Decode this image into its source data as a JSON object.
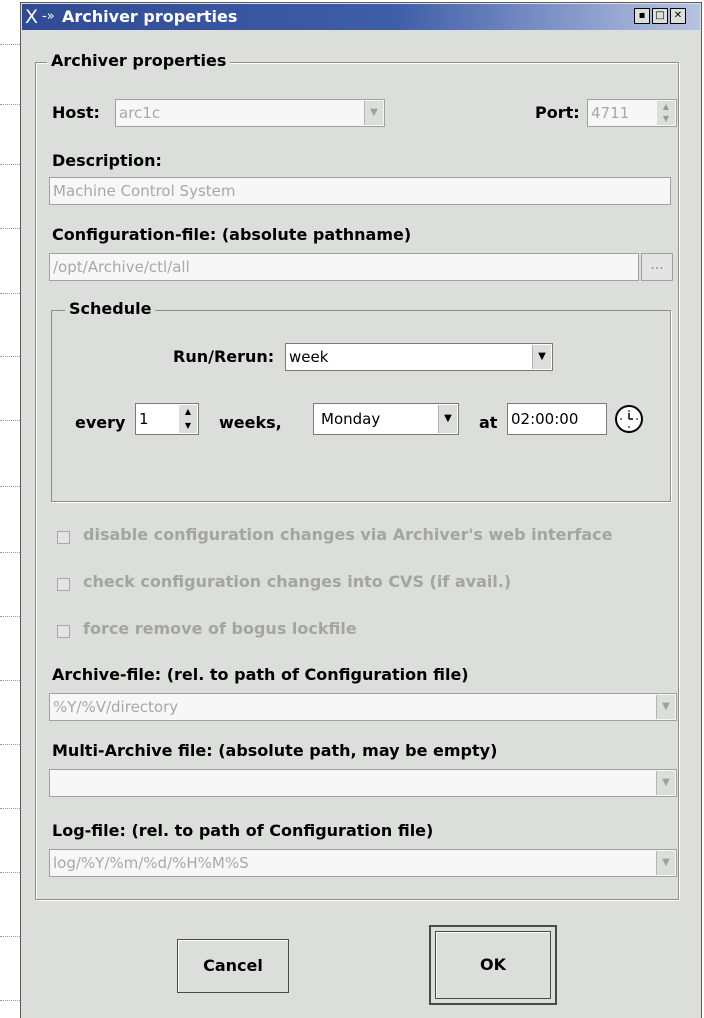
{
  "window": {
    "title": "Archiver properties",
    "close_glyph": "X",
    "pin_glyph": "-»",
    "buttons": [
      "minimize-icon",
      "maximize-icon",
      "close-icon"
    ]
  },
  "group_title": "Archiver properties",
  "host": {
    "label": "Host:",
    "value": "arc1c"
  },
  "port": {
    "label": "Port:",
    "value": "4711"
  },
  "description": {
    "label": "Description:",
    "value": "Machine Control System"
  },
  "config_file": {
    "label": "Configuration-file: (absolute pathname)",
    "value": "/opt/Archive/ctl/all",
    "browse_label": "..."
  },
  "schedule": {
    "title": "Schedule",
    "run_label": "Run/Rerun:",
    "run_value": "week",
    "every_label": "every",
    "every_value": "1",
    "weeks_label": "weeks,",
    "day_value": "Monday",
    "at_label": "at",
    "time_value": "02:00:00"
  },
  "checkboxes": [
    {
      "label": "disable configuration changes via Archiver's web interface",
      "checked": false
    },
    {
      "label": "check configuration changes into CVS (if avail.)",
      "checked": false
    },
    {
      "label": "force remove of bogus lockfile",
      "checked": false
    }
  ],
  "archive_file": {
    "label": "Archive-file: (rel. to path of Configuration file)",
    "value": "%Y/%V/directory"
  },
  "multi_archive_file": {
    "label": "Multi-Archive file: (absolute path, may be empty)",
    "value": ""
  },
  "log_file": {
    "label": "Log-file: (rel. to path of Configuration file)",
    "value": "log/%Y/%m/%d/%H%M%S"
  },
  "buttons": {
    "cancel": "Cancel",
    "ok": "OK"
  },
  "colors": {
    "titlebar": "#2f4b93",
    "window_bg": "#dcdedb",
    "disabled_text": "#a4a4a4"
  }
}
